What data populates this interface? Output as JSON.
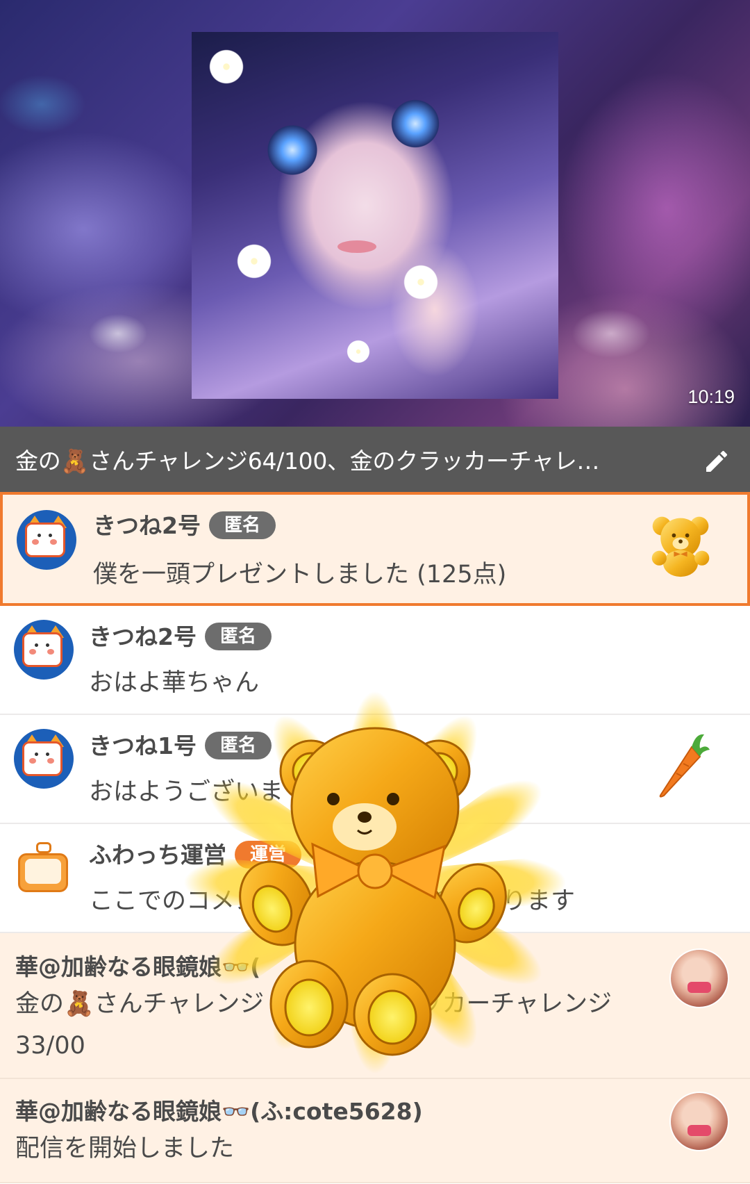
{
  "stream": {
    "time": "10:19"
  },
  "title_bar": {
    "title": "金の🧸さんチャレンジ64/100、金のクラッカーチャレ…",
    "edit_icon": "pencil-icon"
  },
  "comments": [
    {
      "type": "gift",
      "user": "きつね2号",
      "badge": "匿名",
      "message": "僕を一頭プレゼントしました (125点)",
      "icon": "gold-teddy-bear-icon"
    },
    {
      "type": "normal",
      "user": "きつね2号",
      "badge": "匿名",
      "message": "おはよ華ちゃん"
    },
    {
      "type": "normal",
      "user": "きつね1号",
      "badge": "匿名",
      "message": "おはようございま",
      "icon": "carrot-icon"
    },
    {
      "type": "staff",
      "user": "ふわっち運営",
      "badge": "運営",
      "message": "ここでのコメン　　　　　　　りになります"
    }
  ],
  "cast_comments": [
    {
      "user": "華@加齢なる眼鏡娘👓(",
      "message": "金の🧸さんチャレンジ　　 　のクラッカーチャレンジ33/00"
    },
    {
      "user": "華@加齢なる眼鏡娘👓(ふ:cote5628)",
      "message": "配信を開始しました"
    }
  ],
  "overlay": {
    "icon": "gold-teddy-bear-burst-icon"
  }
}
